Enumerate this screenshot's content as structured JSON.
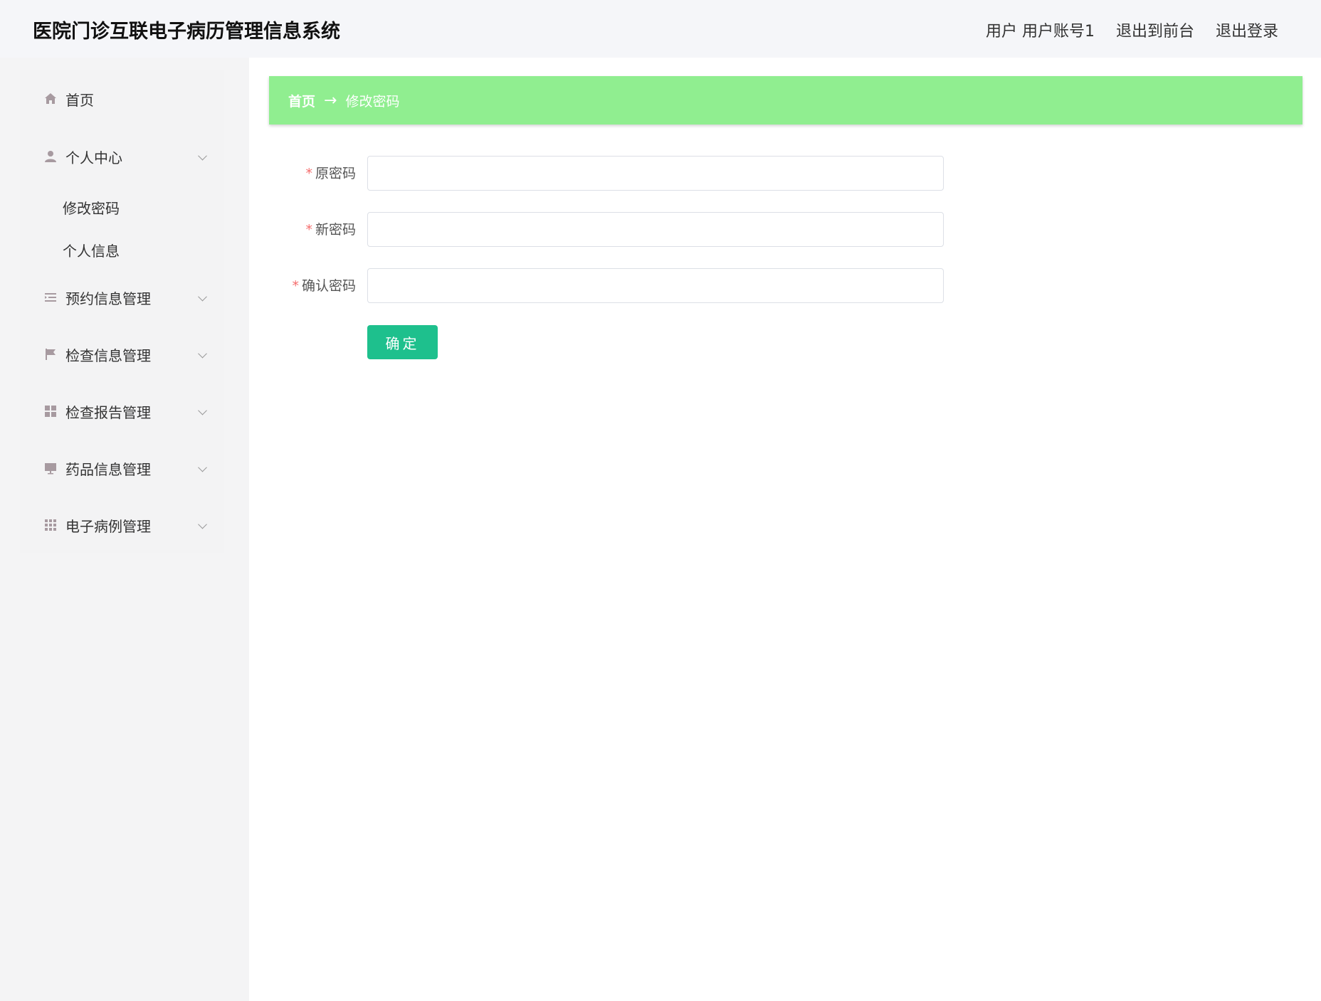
{
  "header": {
    "title": "医院门诊互联电子病历管理信息系统",
    "user_text": "用户 用户账号1",
    "to_front_label": "退出到前台",
    "logout_label": "退出登录"
  },
  "sidebar": {
    "items": [
      {
        "label": "首页",
        "icon": "home-icon"
      },
      {
        "label": "个人中心",
        "icon": "user-icon",
        "expanded": true,
        "children": [
          {
            "label": "修改密码"
          },
          {
            "label": "个人信息"
          }
        ]
      },
      {
        "label": "预约信息管理",
        "icon": "list-icon"
      },
      {
        "label": "检查信息管理",
        "icon": "flag-icon"
      },
      {
        "label": "检查报告管理",
        "icon": "grid-icon"
      },
      {
        "label": "药品信息管理",
        "icon": "monitor-icon"
      },
      {
        "label": "电子病例管理",
        "icon": "apps-icon"
      }
    ]
  },
  "breadcrumb": {
    "home": "首页",
    "separator": "→",
    "current": "修改密码"
  },
  "form": {
    "required_mark": "*",
    "old_password_label": "原密码",
    "old_password_value": "",
    "new_password_label": "新密码",
    "new_password_value": "",
    "confirm_password_label": "确认密码",
    "confirm_password_value": "",
    "submit_label": "确定"
  },
  "colors": {
    "breadcrumb_bg": "#90ee90",
    "button_bg": "#1ec08d",
    "required": "#f56c6c"
  }
}
